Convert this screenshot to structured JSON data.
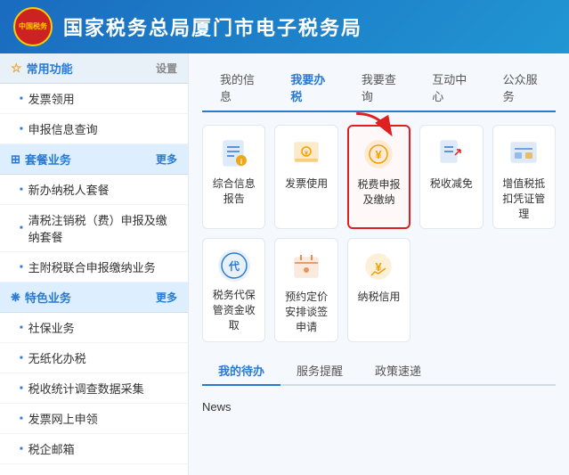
{
  "header": {
    "title": "国家税务总局厦门市电子税务局",
    "logo_text": "中国税务"
  },
  "sidebar": {
    "sections": [
      {
        "id": "common",
        "label": "常用功能",
        "icon": "star",
        "right_label": "设置",
        "items": [
          "发票领用",
          "申报信息查询"
        ]
      },
      {
        "id": "package",
        "label": "套餐业务",
        "icon": "grid",
        "right_label": "更多",
        "items": [
          "新办纳税人套餐",
          "清税注销税（费）申报及缴纳套餐",
          "主附税联合申报缴纳业务"
        ]
      },
      {
        "id": "special",
        "label": "特色业务",
        "icon": "flower",
        "right_label": "更多",
        "items": [
          "社保业务",
          "无纸化办税",
          "税收统计调查数据采集",
          "发票网上申领",
          "税企邮箱"
        ]
      }
    ],
    "news_label": "News"
  },
  "top_nav": {
    "items": [
      "我的信息",
      "我要办税",
      "我要查询",
      "互动中心",
      "公众服务"
    ],
    "active": "我要办税"
  },
  "services": [
    {
      "id": "综合信息报告",
      "label": "综合信息报告",
      "icon": "📋",
      "highlighted": false
    },
    {
      "id": "发票使用",
      "label": "发票使用",
      "icon": "🧾",
      "highlighted": false
    },
    {
      "id": "税费申报及缴纳",
      "label": "税费申报及缴纳",
      "icon": "💰",
      "highlighted": true
    },
    {
      "id": "税收减免",
      "label": "税收减免",
      "icon": "📄",
      "highlighted": false
    },
    {
      "id": "增值税抵扣凭证管理",
      "label": "增值税抵扣凭证管理",
      "icon": "🗂️",
      "highlighted": false
    },
    {
      "id": "税务代保管资金收取",
      "label": "税务代保管资金收取",
      "icon": "代",
      "highlighted": false
    },
    {
      "id": "预约定价安排谈签申请",
      "label": "预约定价安排谈签申请",
      "icon": "📅",
      "highlighted": false
    },
    {
      "id": "纳税信用",
      "label": "纳税信用",
      "icon": "🏆",
      "highlighted": false
    }
  ],
  "bottom_nav": {
    "items": [
      "我的待办",
      "服务提醒",
      "政策速递"
    ],
    "active": "我的待办"
  }
}
